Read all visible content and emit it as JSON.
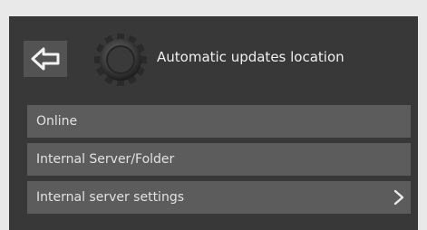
{
  "header": {
    "title": "Automatic updates location",
    "back_icon": "back-arrow-icon",
    "settings_icon": "gear-icon"
  },
  "menu": {
    "items": [
      {
        "label": "Online",
        "icon": ""
      },
      {
        "label": "Internal Server/Folder",
        "icon": ""
      },
      {
        "label": "Internal server settings",
        "icon": "chevron-right-icon"
      }
    ]
  },
  "colors": {
    "page_background": "#e9e9e9",
    "screen_background": "#383838",
    "button_background": "#5c5c5c",
    "back_button_background": "#535353",
    "text": "#f0f0f0"
  }
}
